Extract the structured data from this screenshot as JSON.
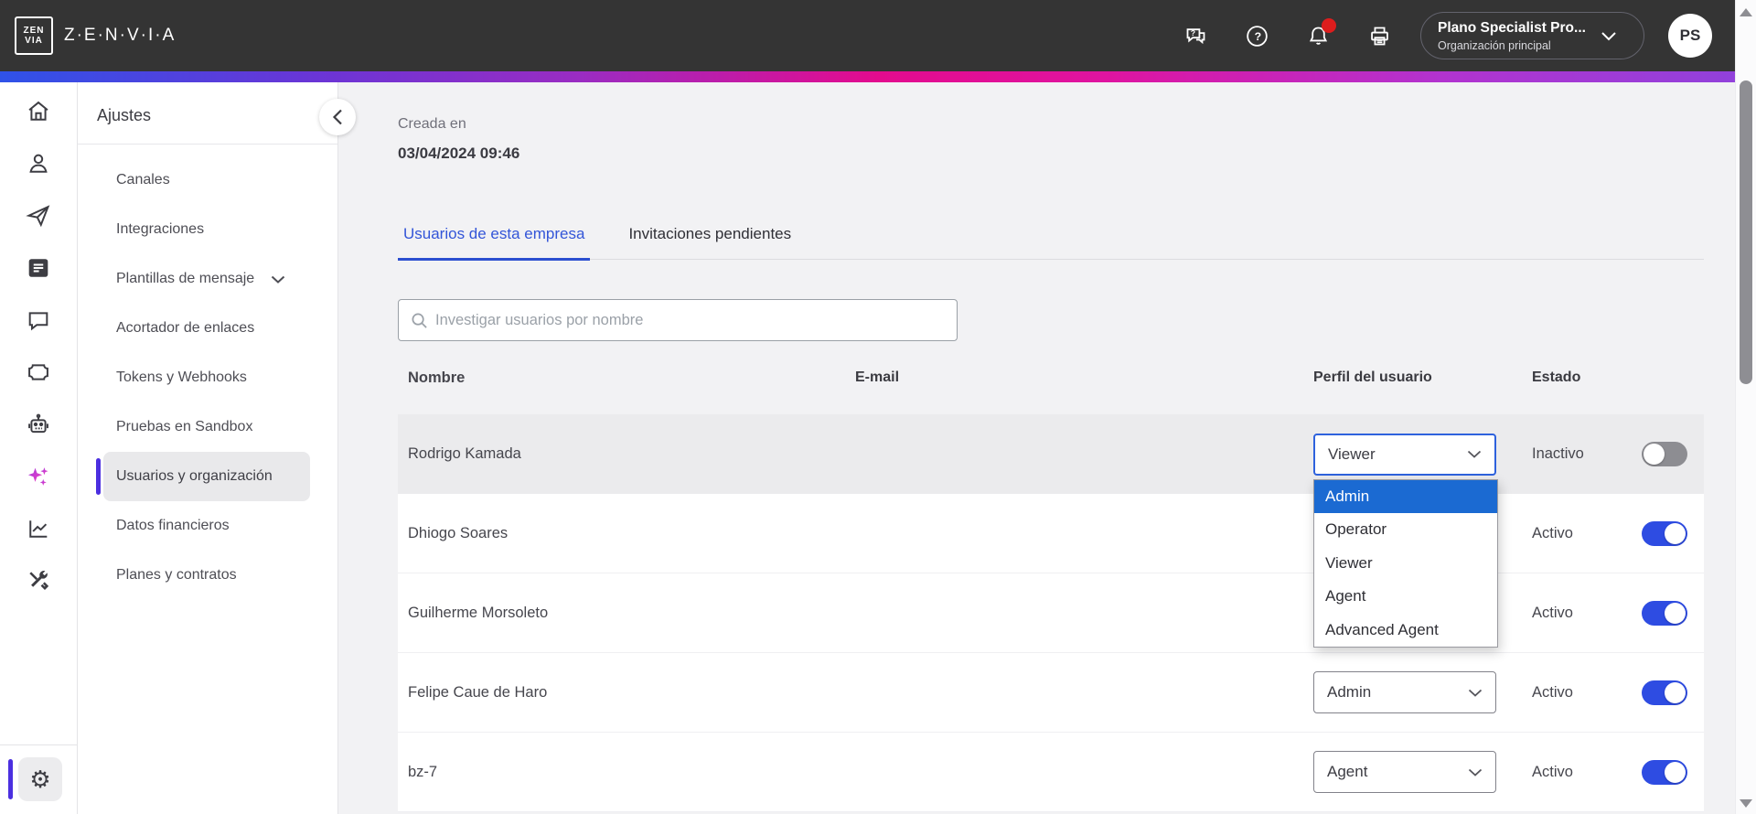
{
  "header": {
    "brand": "Z·E·N·V·I·A",
    "logo_top": "ZEN",
    "logo_bottom": "VIA",
    "icons": [
      "support-chat-icon",
      "help-icon",
      "notifications-bell-icon",
      "printer-icon"
    ],
    "org_selector": {
      "title": "Plano Specialist Pro...",
      "subtitle": "Organización principal"
    },
    "avatar_initials": "PS"
  },
  "icon_rail": {
    "items": [
      "home",
      "contacts",
      "send",
      "news",
      "chat",
      "ticket",
      "bot",
      "ai-sparkles",
      "reports",
      "tools"
    ],
    "bottom": "settings-gear"
  },
  "sidebar": {
    "title": "Ajustes",
    "items": [
      {
        "label": "Canales",
        "active": false
      },
      {
        "label": "Integraciones",
        "active": false
      },
      {
        "label": "Plantillas de mensaje",
        "active": false,
        "has_chevron": true
      },
      {
        "label": "Acortador de enlaces",
        "active": false
      },
      {
        "label": "Tokens y Webhooks",
        "active": false
      },
      {
        "label": "Pruebas en Sandbox",
        "active": false
      },
      {
        "label": "Usuarios y organización",
        "active": true
      },
      {
        "label": "Datos financieros",
        "active": false
      },
      {
        "label": "Planes y contratos",
        "active": false
      }
    ]
  },
  "main": {
    "created_label": "Creada en",
    "created_value": "03/04/2024 09:46",
    "tabs": [
      {
        "label": "Usuarios de esta empresa",
        "active": true
      },
      {
        "label": "Invitaciones pendientes",
        "active": false
      }
    ],
    "search": {
      "placeholder": "Investigar usuarios por nombre"
    },
    "table": {
      "columns": [
        "Nombre",
        "E-mail",
        "Perfil del usuario",
        "Estado"
      ],
      "profile_options": [
        "Admin",
        "Operator",
        "Viewer",
        "Agent",
        "Advanced Agent"
      ],
      "highlighted_option": "Admin",
      "rows": [
        {
          "name": "Rodrigo Kamada",
          "email": "",
          "profile": "Viewer",
          "status": "Inactivo",
          "enabled": false,
          "dropdown_open": true
        },
        {
          "name": "Dhiogo Soares",
          "email": "",
          "profile": "",
          "status": "Activo",
          "enabled": true
        },
        {
          "name": "Guilherme Morsoleto",
          "email": "",
          "profile": "",
          "status": "Activo",
          "enabled": true
        },
        {
          "name": "Felipe Caue de Haro",
          "email": "",
          "profile": "Admin",
          "status": "Activo",
          "enabled": true
        },
        {
          "name": "bz-7",
          "email": "",
          "profile": "Agent",
          "status": "Activo",
          "enabled": true
        }
      ]
    }
  },
  "colors": {
    "header_bg": "#343434",
    "accent_blue": "#3355d8",
    "toggle_on": "#2e4ce2",
    "dropdown_highlight": "#1b6ad2",
    "sidebar_active_indicator": "#4b2fe0",
    "notification_badge": "#dd1d1d",
    "gradient": [
      "#2f52e8",
      "#6a35d6",
      "#e30b8e",
      "#b233cf",
      "#8f42dc"
    ]
  }
}
